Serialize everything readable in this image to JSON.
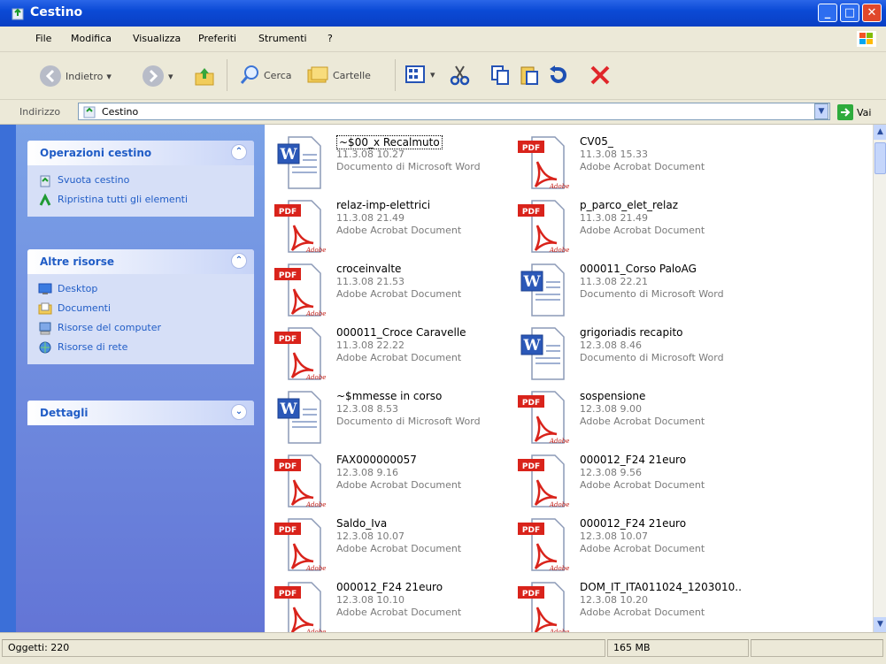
{
  "window": {
    "title": "Cestino"
  },
  "menu": [
    "File",
    "Modifica",
    "Visualizza",
    "Preferiti",
    "Strumenti",
    "?"
  ],
  "toolbar": {
    "back": "Indietro",
    "search": "Cerca",
    "folders": "Cartelle"
  },
  "address": {
    "label": "Indirizzo",
    "value": "Cestino",
    "go": "Vai"
  },
  "sidebar": {
    "panels": [
      {
        "title": "Operazioni cestino",
        "items": [
          "Svuota cestino",
          "Ripristina tutti gli elementi"
        ]
      },
      {
        "title": "Altre risorse",
        "items": [
          "Desktop",
          "Documenti",
          "Risorse del computer",
          "Risorse di rete"
        ]
      },
      {
        "title": "Dettagli",
        "items": []
      }
    ]
  },
  "files": [
    {
      "name": "~$00_x Recalmuto",
      "date": "11.3.08 10.27",
      "type": "Documento di Microsoft Word",
      "kind": "word",
      "selected": true
    },
    {
      "name": "CV05_",
      "date": "11.3.08 15.33",
      "type": "Adobe Acrobat Document",
      "kind": "pdf"
    },
    {
      "name": "relaz-imp-elettrici",
      "date": "11.3.08 21.49",
      "type": "Adobe Acrobat Document",
      "kind": "pdf"
    },
    {
      "name": "p_parco_elet_relaz",
      "date": "11.3.08 21.49",
      "type": "Adobe Acrobat Document",
      "kind": "pdf"
    },
    {
      "name": "croceinvalte",
      "date": "11.3.08 21.53",
      "type": "Adobe Acrobat Document",
      "kind": "pdf"
    },
    {
      "name": "000011_Corso PaloAG",
      "date": "11.3.08 22.21",
      "type": "Documento di Microsoft Word",
      "kind": "word"
    },
    {
      "name": "000011_Croce Caravelle",
      "date": "11.3.08 22.22",
      "type": "Adobe Acrobat Document",
      "kind": "pdf"
    },
    {
      "name": "grigoriadis recapito",
      "date": "12.3.08 8.46",
      "type": "Documento di Microsoft Word",
      "kind": "word"
    },
    {
      "name": "~$mmesse in corso",
      "date": "12.3.08 8.53",
      "type": "Documento di Microsoft Word",
      "kind": "word"
    },
    {
      "name": "sospensione",
      "date": "12.3.08 9.00",
      "type": "Adobe Acrobat Document",
      "kind": "pdf"
    },
    {
      "name": "FAX000000057",
      "date": "12.3.08 9.16",
      "type": "Adobe Acrobat Document",
      "kind": "pdf"
    },
    {
      "name": "000012_F24 21euro",
      "date": "12.3.08 9.56",
      "type": "Adobe Acrobat Document",
      "kind": "pdf"
    },
    {
      "name": "Saldo_Iva",
      "date": "12.3.08 10.07",
      "type": "Adobe Acrobat Document",
      "kind": "pdf"
    },
    {
      "name": "000012_F24 21euro",
      "date": "12.3.08 10.07",
      "type": "Adobe Acrobat Document",
      "kind": "pdf"
    },
    {
      "name": "000012_F24 21euro",
      "date": "12.3.08 10.10",
      "type": "Adobe Acrobat Document",
      "kind": "pdf"
    },
    {
      "name": "DOM_IT_ITA011024_1203010..",
      "date": "12.3.08 10.20",
      "type": "Adobe Acrobat Document",
      "kind": "pdf"
    }
  ],
  "status": {
    "objects": "Oggetti: 220",
    "size": "165 MB"
  },
  "colors": {
    "title_blue": "#0b4ad6",
    "link_blue": "#215dc6",
    "pdf_red": "#d9231b"
  }
}
